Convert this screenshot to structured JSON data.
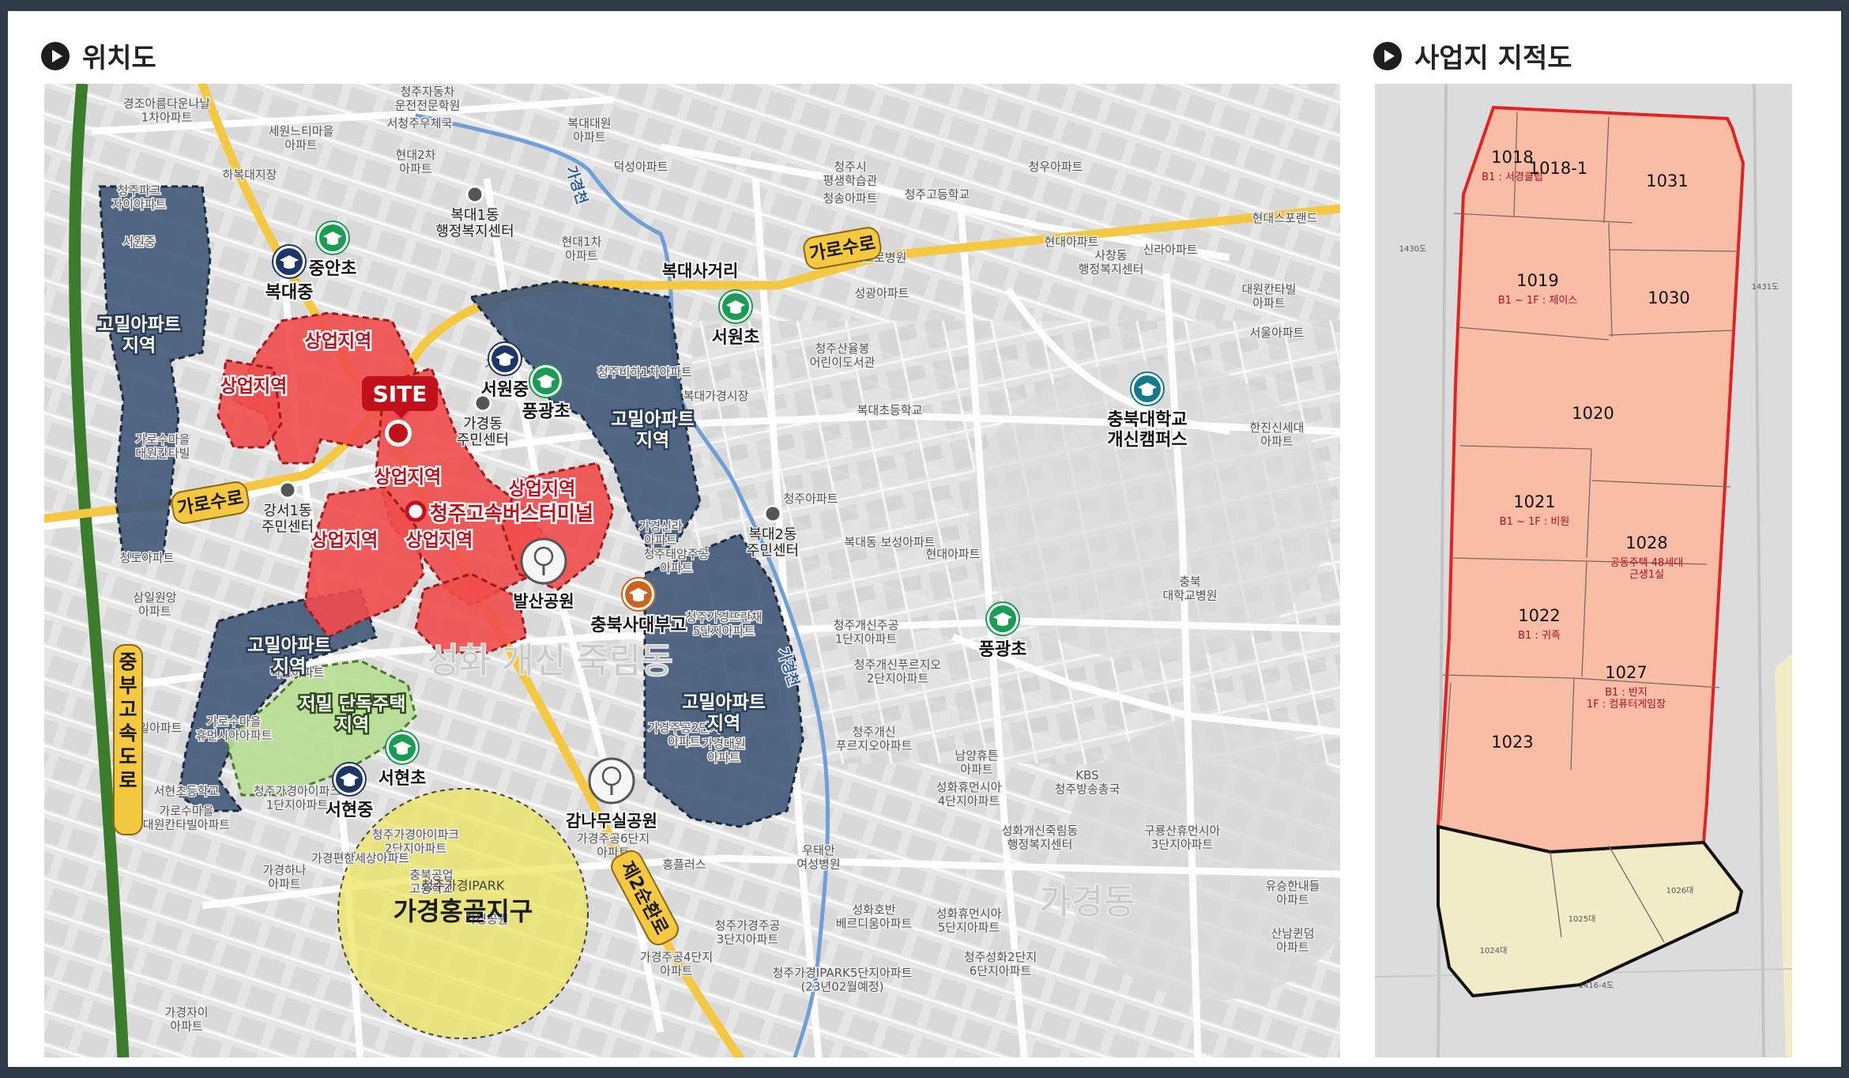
{
  "headers": {
    "location": "위치도",
    "cadastral": "사업지 지적도"
  },
  "map": {
    "site": "SITE",
    "zones": [
      {
        "label": "고밀아파트\n지역",
        "kind": "high-density"
      },
      {
        "label": "고밀아파트\n지역",
        "kind": "high-density"
      },
      {
        "label": "고밀아파트\n지역",
        "kind": "high-density"
      },
      {
        "label": "고밀아파트\n지역",
        "kind": "high-density"
      },
      {
        "label": "저밀 단독주택\n지역",
        "kind": "low-density"
      },
      {
        "label": "상업지역",
        "kind": "commercial"
      },
      {
        "label": "상업지역",
        "kind": "commercial"
      },
      {
        "label": "상업지역",
        "kind": "commercial"
      },
      {
        "label": "상업지역",
        "kind": "commercial"
      },
      {
        "label": "상업지역",
        "kind": "commercial"
      },
      {
        "label": "상업지역",
        "kind": "commercial"
      }
    ],
    "bus_terminal": "청주고속버스터미널",
    "roads": [
      "가로수로",
      "가로수로",
      "제2순환로",
      "중부고속도로"
    ],
    "streams": [
      "가경천",
      "가경천"
    ],
    "intersection": "복대사거리",
    "schools": [
      {
        "name": "중안초",
        "type": "elementary"
      },
      {
        "name": "복대중",
        "type": "middle"
      },
      {
        "name": "서원중",
        "type": "middle"
      },
      {
        "name": "풍광초",
        "type": "elementary"
      },
      {
        "name": "서원초",
        "type": "elementary"
      },
      {
        "name": "충북사대부고",
        "type": "high"
      },
      {
        "name": "풍광초",
        "type": "elementary"
      },
      {
        "name": "서현초",
        "type": "elementary"
      },
      {
        "name": "서현중",
        "type": "middle"
      },
      {
        "name": "충북대학교\n개신캠퍼스",
        "type": "university"
      }
    ],
    "parks": [
      "발산공원",
      "감나무실공원"
    ],
    "community_centers": [
      "복대1동\n행정복지센터",
      "가경동\n주민센터",
      "강서1동\n주민센터",
      "복대2동\n주민센터"
    ],
    "district": {
      "name": "가경홍골지구",
      "sub": "청주가경IPARK"
    },
    "background_labels": [
      "청주자동차\n운전전문학원",
      "경조아름다운나날\n1차아파트",
      "세원느티마을\n아파트",
      "서청주우체국",
      "복대대원\n아파트",
      "현대2차\n아파트",
      "하복대지장",
      "청주파크\n자이아파트",
      "덕성아파트",
      "청주시\n평생학습관",
      "청주고등학교",
      "청송아파트",
      "청우아파트",
      "마이크로병원",
      "현대아파트",
      "사창동\n행정복지센터",
      "신라아파트",
      "현대스포랜드",
      "대원칸타빌\n아파트",
      "서울아파트",
      "성광아파트",
      "청주산율봉\n어린이도서관",
      "복대가경시장",
      "복대초등학교",
      "한진신세대\n아파트",
      "현대1차\n아파트",
      "청주아파트",
      "복대동 보성아파트",
      "현대아파트",
      "청주개신주공\n1단지아파트",
      "청주개신푸르지오\n2단지아파트",
      "청주개신\n푸르지오아파트",
      "남양휴튼\n아파트",
      "KBS\n청주방송총국",
      "충북\n대학교병원",
      "성화휴먼시아\n4단지아파트",
      "성화개신죽림동\n행정복지센터",
      "구룡산휴먼시아\n3단지아파트",
      "유승한내들\n아파트",
      "산남퀸덤\n아파트",
      "성화호반\n베르디움아파트",
      "성화휴먼시아\n5단지아파트",
      "청주성화2단지\n6단지아파트",
      "청주가경주공\n3단지아파트",
      "가경주공4단지\n아파트",
      "우태안\n여성병원",
      "흥플러스",
      "가경주공6단지\n아파트",
      "청주가경아이파크\n1단지아파트",
      "청주가경아이파크\n2단지아파트",
      "충북공업\n고등학교",
      "가경공원",
      "청주가경IPARK5단지아파트\n(23년02월예정)",
      "가경자이\n아파트",
      "가경하나\n아파트",
      "가경편한세상아파트",
      "서현초등학교",
      "가로수마을\n대원칸타빌아파트",
      "가로수마을\n휴먼시아아파트",
      "덕흥아파트",
      "청도아파트",
      "삼일원앙\n아파트",
      "청주태암주공\n아파트",
      "청주가경뜨란채\n5단지아파트",
      "가경주공2단지\n아파트",
      "가경대원\n아파트",
      "가경신라\n아파트",
      "청주비하1차아파트",
      "가로수마을\n대원칸타빌",
      "삼일아파트",
      "서원중",
      "가경동",
      "성화 개신 죽림동",
      "가경동"
    ]
  },
  "cadastral": {
    "site_parcels": [
      {
        "no": "1018",
        "note": "B1 : 서경클럽"
      },
      {
        "no": "1018-1",
        "note": ""
      },
      {
        "no": "1031",
        "note": ""
      },
      {
        "no": "1019",
        "note": "B1 ~ 1F : 체이스"
      },
      {
        "no": "1030",
        "note": ""
      },
      {
        "no": "1020",
        "note": ""
      },
      {
        "no": "1021",
        "note": "B1 ~ 1F : 비원"
      },
      {
        "no": "1028",
        "note": "공동주택 48세대\n근생1실"
      },
      {
        "no": "1022",
        "note": "B1 : 귀족"
      },
      {
        "no": "1027",
        "note": "B1 : 반지\n1F : 컴퓨터게임장"
      },
      {
        "no": "1023",
        "note": ""
      }
    ],
    "other_parcels": [
      "1026대",
      "1025대",
      "1024대"
    ],
    "edge_labels": [
      "1430도",
      "1431도",
      "1416-4도"
    ]
  },
  "colors": {
    "high_density": "#3f5878",
    "commercial": "#ef4b4b",
    "low_density": "#b7dd92",
    "district_circle": "#ece45a",
    "road": "#f5c842",
    "expressway": "#3b7d2c",
    "stream": "#6f9fd8",
    "site_marker": "#c0101c",
    "parcel_fill": "#f9bca5",
    "parcel_outline": "#e02424",
    "other_parcel_fill": "#f1ebc8",
    "elementary_school": "#1a9c53",
    "middle_school": "#1d3668",
    "high_school": "#c9651e",
    "university": "#127a8a"
  }
}
